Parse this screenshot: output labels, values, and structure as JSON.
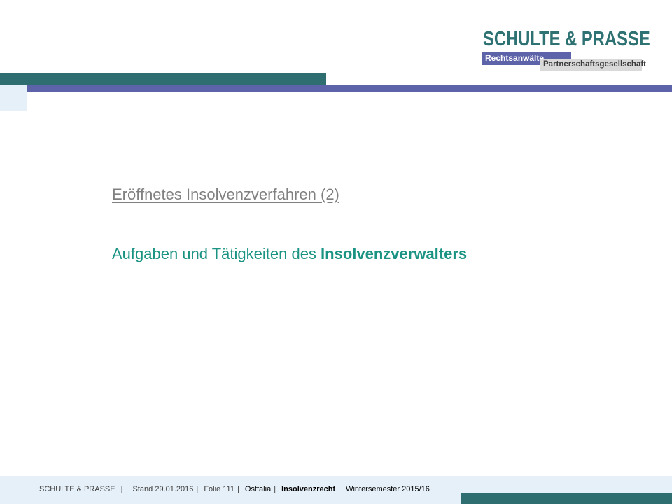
{
  "logo": {
    "name": "SCHULTE & PRASSE",
    "tag1": "Rechtsanwälte",
    "tag2": "Partnerschaftsgesellschaft"
  },
  "slide": {
    "section_title": "Eröffnetes Insolvenzverfahren (2)",
    "subtitle_normal": "Aufgaben und Tätigkeiten des ",
    "subtitle_bold": "Insolvenzverwalters"
  },
  "footer": {
    "firm": "SCHULTE & PRASSE",
    "stand_label": "Stand",
    "stand_date": "29.01.2016",
    "folie_label": "Folie",
    "folie_number": "111",
    "institution": "Ostfalia",
    "course": "Insolvenzrecht",
    "semester": "Wintersemester 2015/16",
    "separator": "|"
  },
  "colors": {
    "teal": "#2e6e70",
    "blue": "#5d63a8",
    "green_text": "#1a9383",
    "light_panel": "#e6f0f8"
  }
}
